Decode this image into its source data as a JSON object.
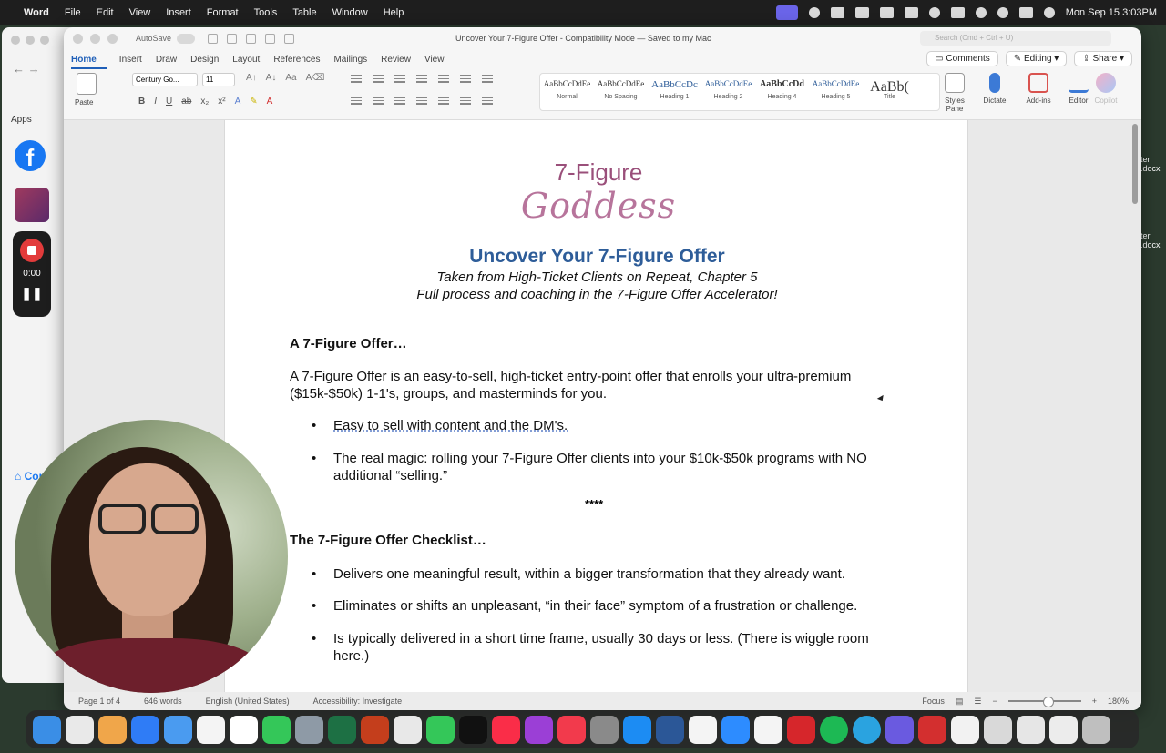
{
  "menubar": {
    "app": "Word",
    "items": [
      "File",
      "Edit",
      "View",
      "Insert",
      "Format",
      "Tools",
      "Table",
      "Window",
      "Help"
    ],
    "clock": "Mon Sep 15  3:03PM"
  },
  "background_window": {
    "apps_label": "Apps",
    "fb_letter": "f",
    "recorder_time": "0:00",
    "home_label": "Com"
  },
  "word": {
    "titlebar": {
      "autosave_label": "AutoSave",
      "doc_title": "Uncover Your 7-Figure Offer  -  Compatibility Mode — Saved to my Mac",
      "search_placeholder": "Search (Cmd + Ctrl + U)"
    },
    "tabs": [
      "Home",
      "Insert",
      "Draw",
      "Design",
      "Layout",
      "References",
      "Mailings",
      "Review",
      "View"
    ],
    "active_tab": "Home",
    "top_right": {
      "comments": "Comments",
      "editing": "Editing",
      "share": "Share"
    },
    "ribbon": {
      "paste": "Paste",
      "font_name": "Century Go...",
      "font_size": "11",
      "styles": [
        {
          "preview": "AaBbCcDdEe",
          "name": "Normal"
        },
        {
          "preview": "AaBbCcDdEe",
          "name": "No Spacing"
        },
        {
          "preview": "AaBbCcDc",
          "name": "Heading 1"
        },
        {
          "preview": "AaBbCcDdEe",
          "name": "Heading 2"
        },
        {
          "preview": "AaBbCcDd",
          "name": "Heading 4"
        },
        {
          "preview": "AaBbCcDdEe",
          "name": "Heading 5"
        },
        {
          "preview": "AaBb(",
          "name": "Title"
        }
      ],
      "styles_pane": "Styles Pane",
      "dictate": "Dictate",
      "addins": "Add-ins",
      "editor": "Editor",
      "copilot": "Copilot"
    },
    "document": {
      "logo_top": "7-Figure",
      "logo_script": "Goddess",
      "title": "Uncover Your 7-Figure Offer",
      "subtitle1": "Taken from High-Ticket Clients on Repeat, Chapter 5",
      "subtitle2": "Full process and coaching in the 7-Figure Offer Accelerator!",
      "section1_heading": "A 7-Figure Offer…",
      "section1_para": "A 7-Figure Offer is an easy-to-sell, high-ticket entry-point offer that enrolls your ultra-premium ($15k-$50k) 1-1's, groups, and masterminds for you.",
      "section1_bullets": [
        "Easy to sell with content and the DM's.",
        "The real magic: rolling your 7-Figure Offer clients into your $10k-$50k programs with NO additional “selling.”"
      ],
      "separator": "****",
      "section2_heading": "The 7-Figure Offer Checklist…",
      "section2_bullets": [
        "Delivers one meaningful result, within a bigger transformation that they already want.",
        "Eliminates or shifts an unpleasant, “in their face” symptom of a frustration or challenge.",
        "Is typically delivered in a short time frame, usually 30 days or less. (There is wiggle room here.)"
      ]
    },
    "statusbar": {
      "page": "Page 1 of 4",
      "words": "646 words",
      "language": "English (United States)",
      "accessibility": "Accessibility: Investigate",
      "focus": "Focus",
      "zoom": "180%"
    }
  },
  "colors": {
    "title_blue": "#2e5d99",
    "logo_purple": "#9a4f7a",
    "tab_blue": "#1f5fb8"
  }
}
